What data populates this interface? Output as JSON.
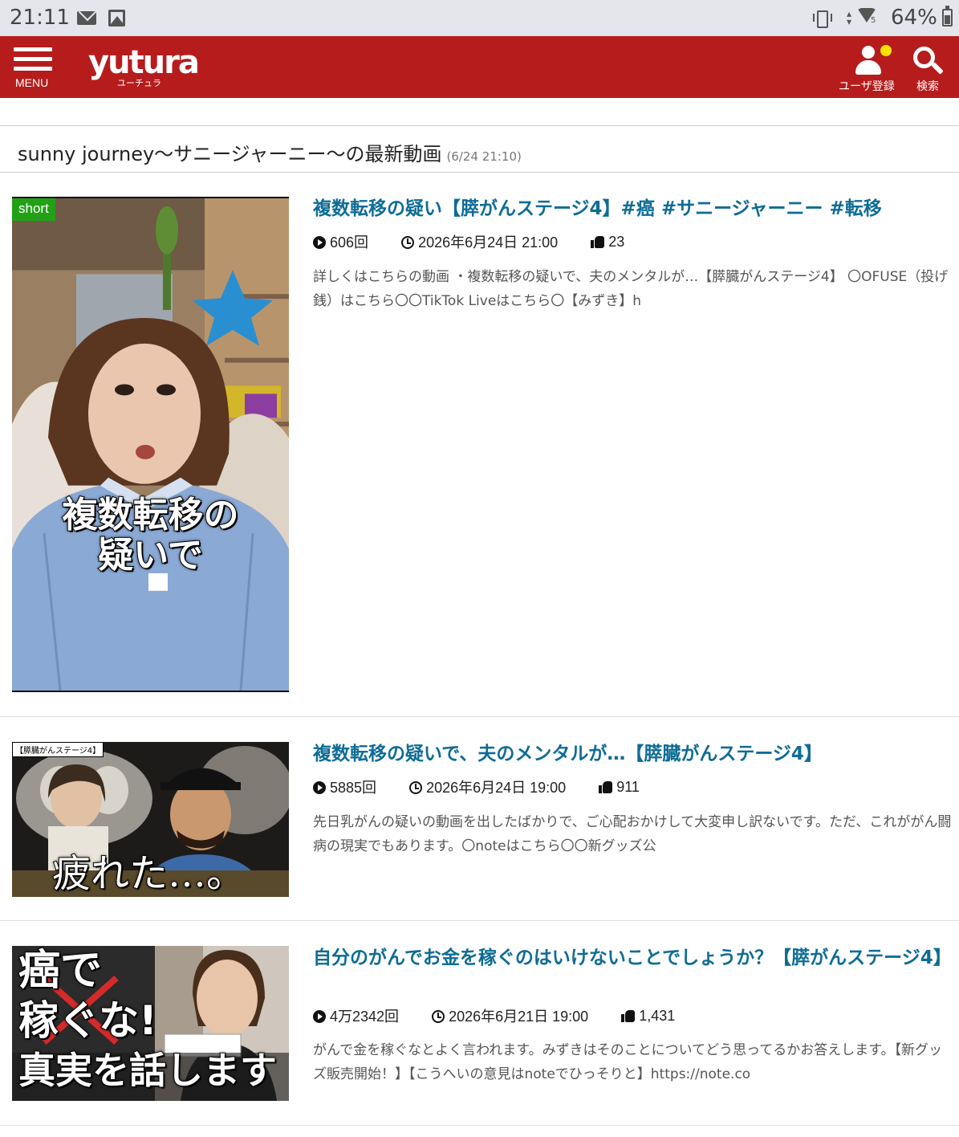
{
  "status_bar": {
    "time": "21:11",
    "battery": "64%",
    "icons": [
      "mail-icon",
      "image-icon",
      "vibrate-icon",
      "data-arrows-icon",
      "wifi-icon",
      "battery-icon"
    ]
  },
  "header": {
    "menu_label": "MENU",
    "logo_text": "yutura",
    "logo_sub": "ユーチュラ",
    "user_label": "ユーザ登録",
    "search_label": "検索",
    "brand_color": "#b71c1c"
  },
  "page": {
    "title": "sunny journey〜サニージャーニー〜の最新動画",
    "updated": "(6/24 21:10)"
  },
  "videos": [
    {
      "badge": "short",
      "thumb_caption": [
        "複数転移の",
        "疑いで"
      ],
      "title": "複数転移の疑い【膵がんステージ4】#癌 #サニージャーニー #転移",
      "views": "606回",
      "date": "2026年6月24日 21:00",
      "likes": "23",
      "description": "詳しくはこちらの動画 ・複数転移の疑いで、夫のメンタルが…【膵臓がんステージ4】 〇OFUSE（投げ銭）はこちら〇〇TikTok Liveはこちら〇【みずき】h"
    },
    {
      "thumb_tag": "【膵臓がんステージ4】",
      "thumb_caption": "疲れた…。",
      "title": "複数転移の疑いで、夫のメンタルが…【膵臓がんステージ4】",
      "views": "5885回",
      "date": "2026年6月24日 19:00",
      "likes": "911",
      "description": "先日乳がんの疑いの動画を出したばかりで、ご心配おかけして大変申し訳ないです。ただ、これががん闘病の現実でもあります。〇noteはこちら〇〇新グッズ公"
    },
    {
      "thumb_caption": [
        "癌で",
        "稼ぐな!",
        "真実を話します"
      ],
      "title": "自分のがんでお金を稼ぐのはいけないことでしょうか？【膵がんステージ4】",
      "views": "4万2342回",
      "date": "2026年6月21日 19:00",
      "likes": "1,431",
      "description": "がんで金を稼ぐなとよく言われます。みずきはそのことについてどう思ってるかお答えします。【新グッズ販売開始！】【こうへいの意見はnoteでひっそりと】https://note.co"
    }
  ]
}
